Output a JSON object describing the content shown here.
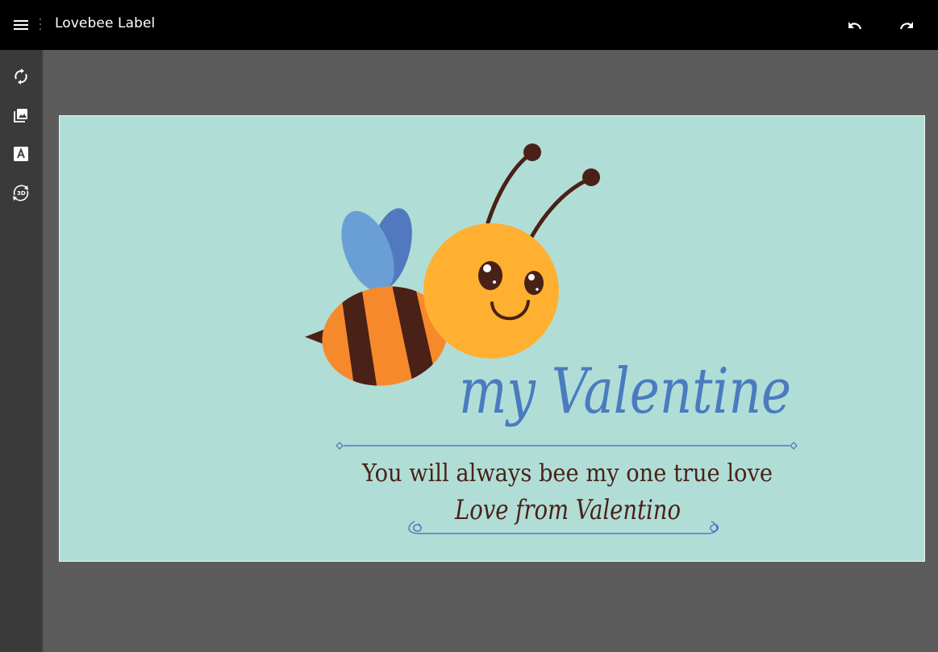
{
  "app": {
    "title": "Lovebee Label"
  },
  "header": {
    "menu_icon": "hamburger-menu-icon",
    "undo_icon": "undo-icon",
    "redo_icon": "redo-icon"
  },
  "sidebar": {
    "items": [
      {
        "name": "sync",
        "icon": "sync-icon"
      },
      {
        "name": "images",
        "icon": "image-icon"
      },
      {
        "name": "text",
        "icon": "text-icon"
      },
      {
        "name": "3d-view",
        "icon": "3d-rotate-icon"
      }
    ]
  },
  "label": {
    "background_color": "#b0ded7",
    "headline": "my Valentine",
    "tagline": "You will always bee my one true love",
    "signature": "Love from Valentino",
    "colors": {
      "headline": "#4b7bbf",
      "text": "#4a2116",
      "bee_body": "#ffb030",
      "bee_stripe": "#4a2116",
      "bee_orange": "#f7892d",
      "wing_light": "#6a9fd5",
      "wing_dark": "#5279bf"
    }
  }
}
